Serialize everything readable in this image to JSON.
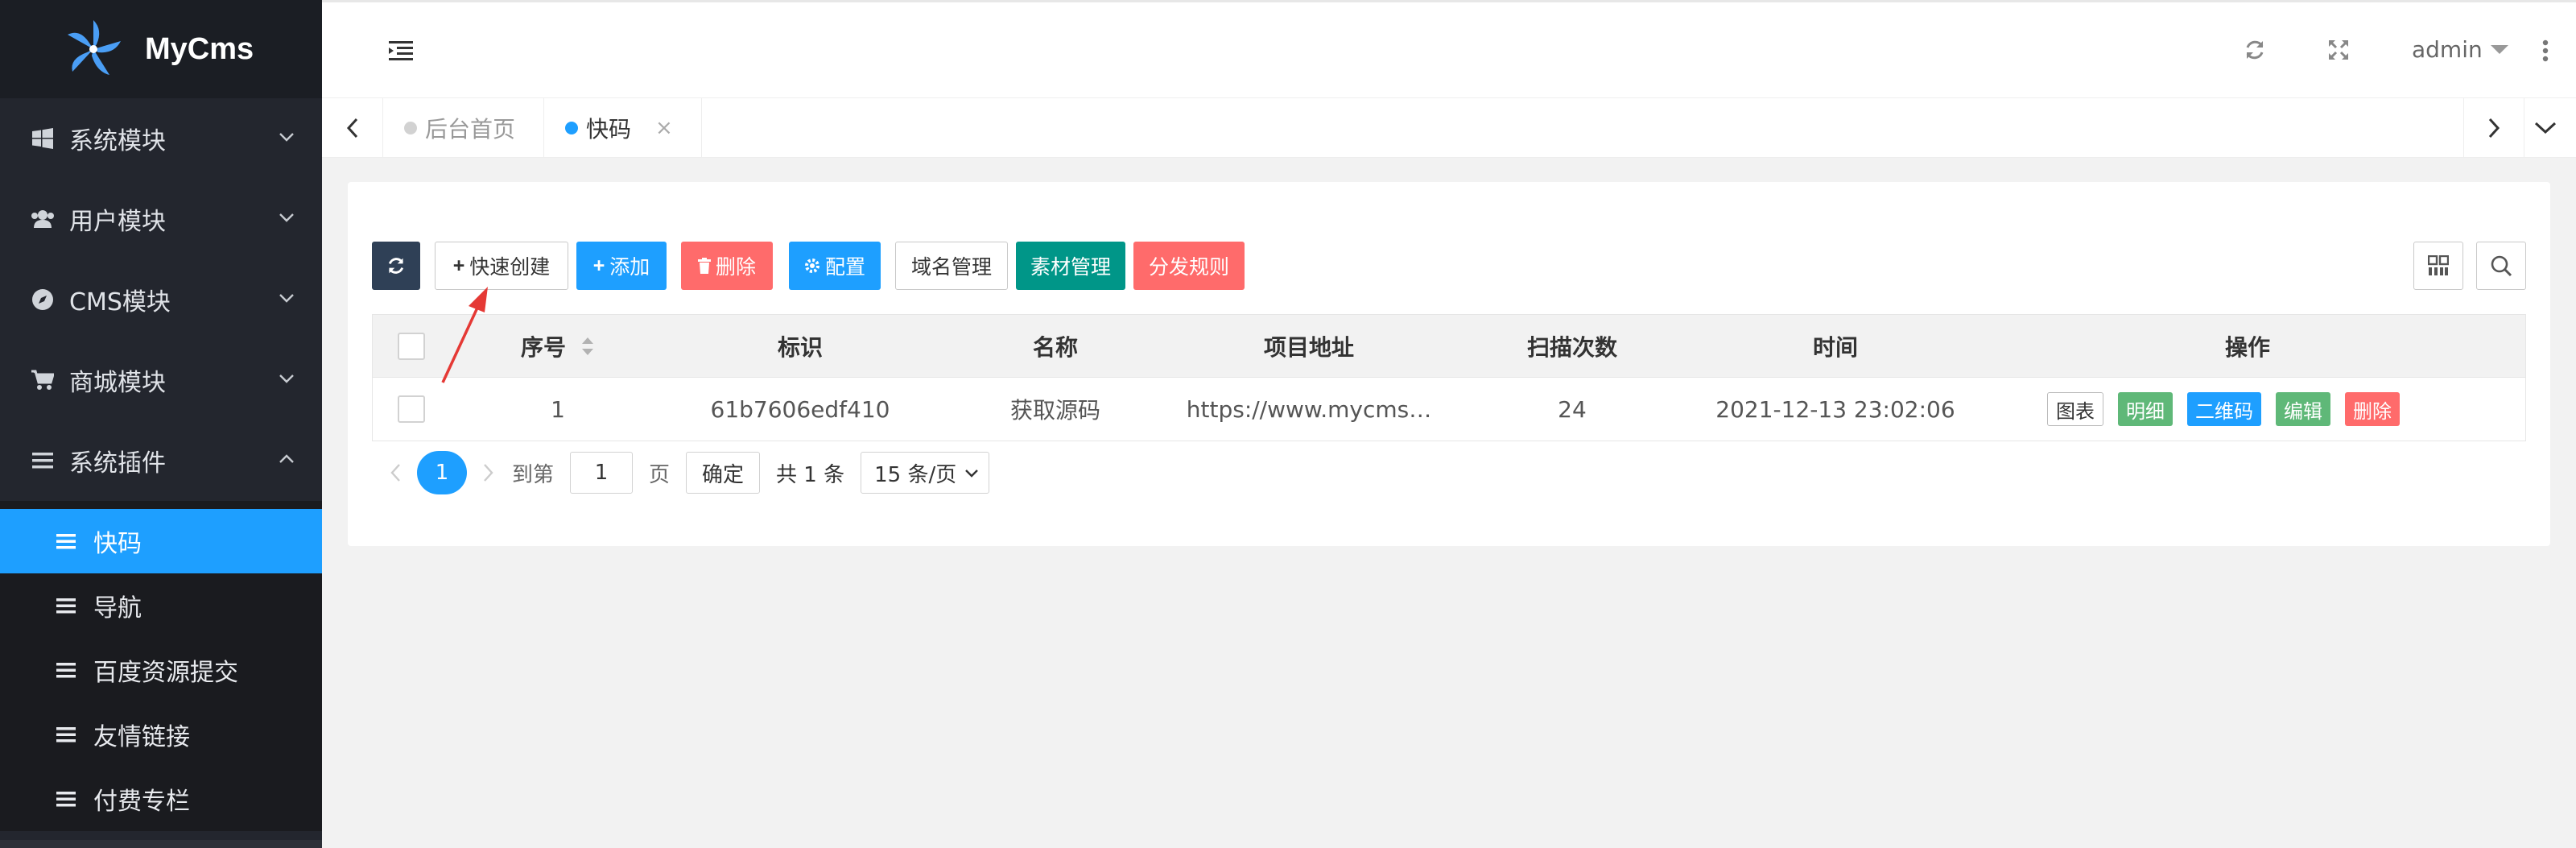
{
  "app": {
    "logo_text": "MyCms"
  },
  "sidebar": {
    "modules": [
      {
        "label": "系统模块",
        "icon": "windows-icon",
        "expanded": false
      },
      {
        "label": "用户模块",
        "icon": "users-icon",
        "expanded": false
      },
      {
        "label": "CMS模块",
        "icon": "compass-icon",
        "expanded": false
      },
      {
        "label": "商城模块",
        "icon": "cart-icon",
        "expanded": false
      },
      {
        "label": "系统插件",
        "icon": "list-icon",
        "expanded": true
      }
    ],
    "plugins": [
      {
        "label": "快码",
        "active": true
      },
      {
        "label": "导航",
        "active": false
      },
      {
        "label": "百度资源提交",
        "active": false
      },
      {
        "label": "友情链接",
        "active": false
      },
      {
        "label": "付费专栏",
        "active": false
      }
    ]
  },
  "header": {
    "user": "admin"
  },
  "tabs": [
    {
      "label": "后台首页",
      "active": false
    },
    {
      "label": "快码",
      "active": true
    }
  ],
  "toolbar": {
    "quick_create": "快速创建",
    "add": "添加",
    "delete": "删除",
    "config": "配置",
    "domain": "域名管理",
    "material": "素材管理",
    "distribute": "分发规则"
  },
  "colors": {
    "primary": "#1e9fff",
    "dark": "#2f4056",
    "danger": "#ff6b6b",
    "success": "#009688",
    "green": "#5fb878",
    "sidebar_bg": "#23262e"
  },
  "table": {
    "headers": [
      "序号",
      "标识",
      "名称",
      "项目地址",
      "扫描次数",
      "时间",
      "操作"
    ],
    "rows": [
      {
        "index": "1",
        "id": "61b7606edf410",
        "name": "获取源码",
        "url": "https://www.mycms…",
        "scans": "24",
        "time": "2021-12-13 23:02:06"
      }
    ],
    "row_actions": [
      "图表",
      "明细",
      "二维码",
      "编辑",
      "删除"
    ]
  },
  "pagination": {
    "current": "1",
    "goto_label": "到第",
    "goto_value": "1",
    "page_label": "页",
    "confirm": "确定",
    "total": "共 1 条",
    "per_page": "15 条/页"
  }
}
